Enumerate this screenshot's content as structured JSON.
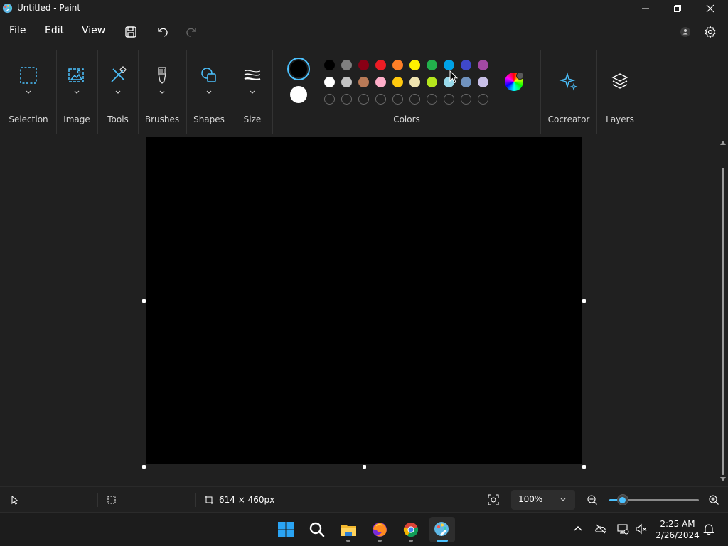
{
  "window": {
    "title": "Untitled - Paint"
  },
  "menu": {
    "file": "File",
    "edit": "Edit",
    "view": "View"
  },
  "ribbon": {
    "groups": [
      {
        "label": "Selection",
        "icon": "selection-rectangle-icon"
      },
      {
        "label": "Image",
        "icon": "image-icon"
      },
      {
        "label": "Tools",
        "icon": "tools-icon"
      },
      {
        "label": "Brushes",
        "icon": "brush-icon"
      },
      {
        "label": "Shapes",
        "icon": "shapes-icon"
      },
      {
        "label": "Size",
        "icon": "size-lines-icon"
      },
      {
        "label": "Colors",
        "icon": "palette-icon"
      },
      {
        "label": "Cocreator",
        "icon": "sparkle-icon"
      },
      {
        "label": "Layers",
        "icon": "layers-icon"
      }
    ],
    "current_color": "#000000",
    "secondary_color": "#ffffff",
    "palette_row1": [
      "#000000",
      "#7f7f7f",
      "#880015",
      "#ed1c24",
      "#ff7f27",
      "#fff200",
      "#22b14c",
      "#00a2e8",
      "#3f48cc",
      "#a349a4"
    ],
    "palette_row2": [
      "#ffffff",
      "#c3c3c3",
      "#b97a57",
      "#ffaec9",
      "#ffc90e",
      "#efe4b0",
      "#b5e61d",
      "#99d9ea",
      "#7092be",
      "#c8bfe7"
    ],
    "palette_row3_empty_count": 10
  },
  "status": {
    "canvas_size": "614 × 460px",
    "zoom": "100%",
    "zoom_slider_fraction": 0.15
  },
  "taskbar": {
    "apps": [
      "start-icon",
      "search-icon",
      "file-explorer-icon",
      "firefox-icon",
      "chrome-icon",
      "paint-icon"
    ],
    "time": "2:25 AM",
    "date": "2/26/2024"
  },
  "theme": {
    "accent": "#4cc2ff",
    "background": "#202020"
  }
}
